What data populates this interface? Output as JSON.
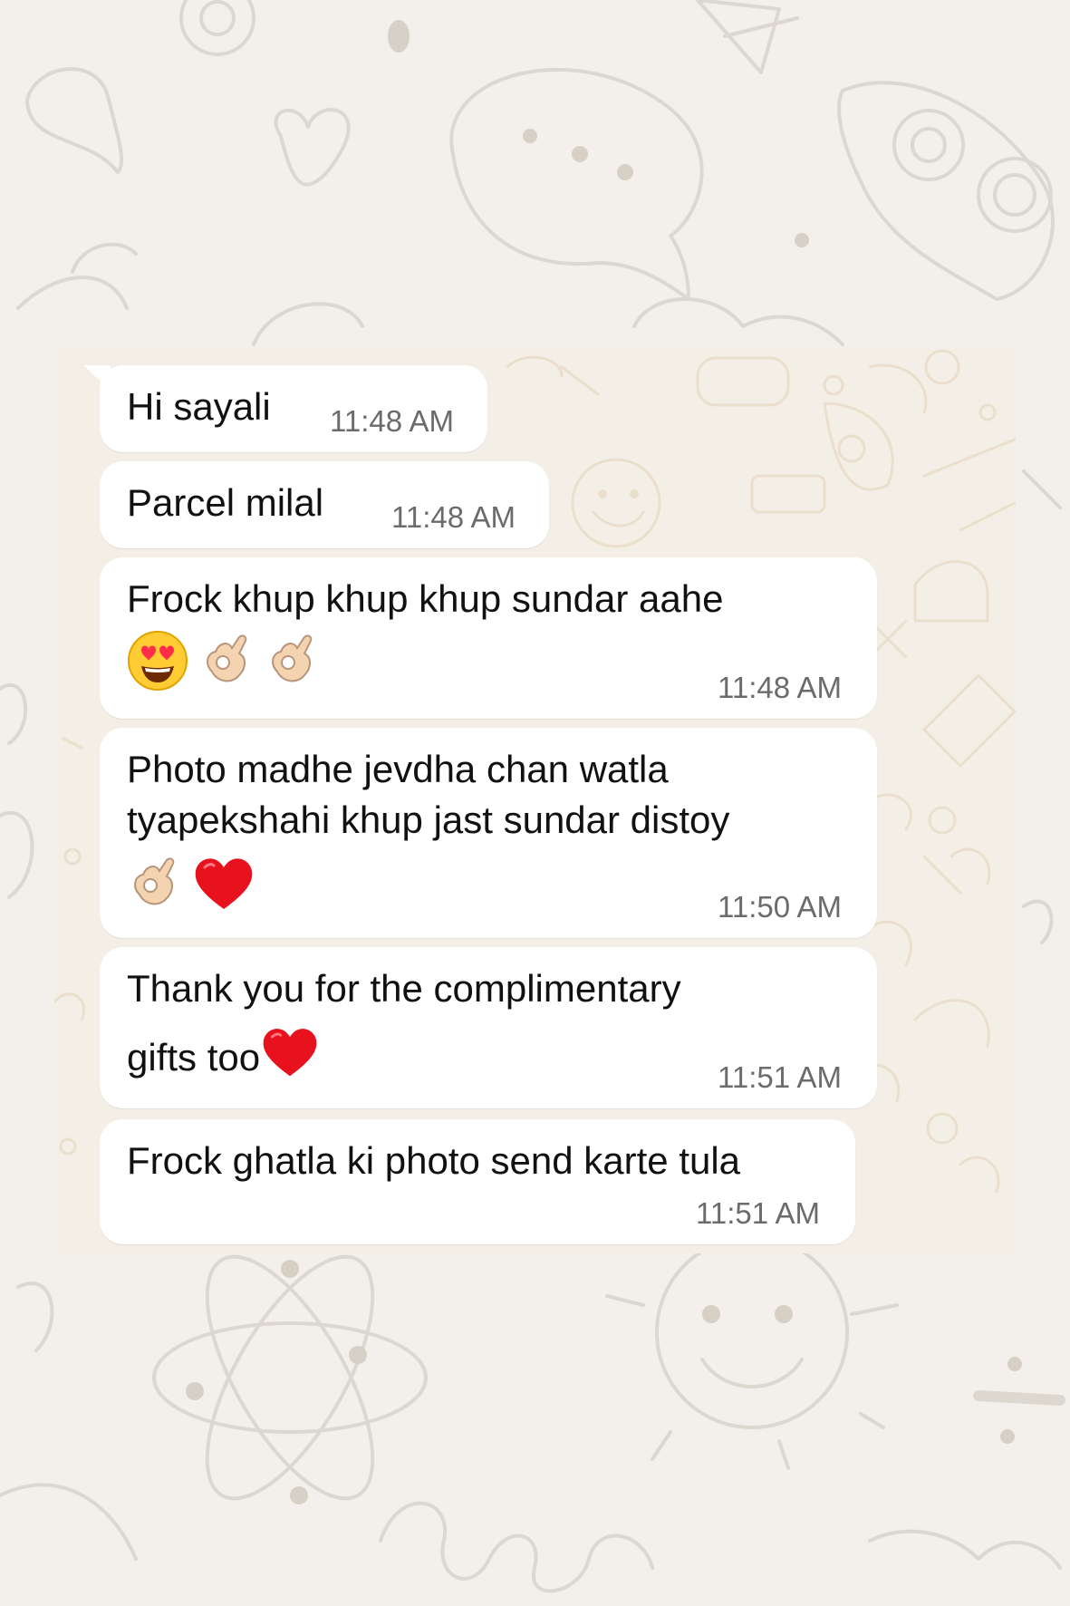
{
  "chat": {
    "messages": [
      {
        "text": "Hi sayali",
        "time": "11:48 AM"
      },
      {
        "text": "Parcel milal",
        "time": "11:48 AM"
      },
      {
        "text": "Frock khup khup khup sundar aahe",
        "emojis": [
          "heart-eyes-emoji",
          "ok-hand-emoji",
          "ok-hand-emoji"
        ],
        "time": "11:48 AM"
      },
      {
        "lines": [
          "Photo madhe jevdha chan watla",
          "tyapekshahi khup jast sundar distoy"
        ],
        "emojis": [
          "ok-hand-emoji",
          "red-heart-emoji"
        ],
        "time": "11:50 AM"
      },
      {
        "lines": [
          "Thank you for the complimentary",
          "gifts too"
        ],
        "trailing_emoji": "red-heart-emoji",
        "time": "11:51 AM"
      },
      {
        "text": "Frock ghatla ki photo send karte tula",
        "time": "11:51 AM"
      }
    ]
  },
  "colors": {
    "page_background": "#f3f0eb",
    "chat_wallpaper": "#f4efe6",
    "bubble": "#ffffff",
    "timestamp": "#6b6b6b"
  }
}
